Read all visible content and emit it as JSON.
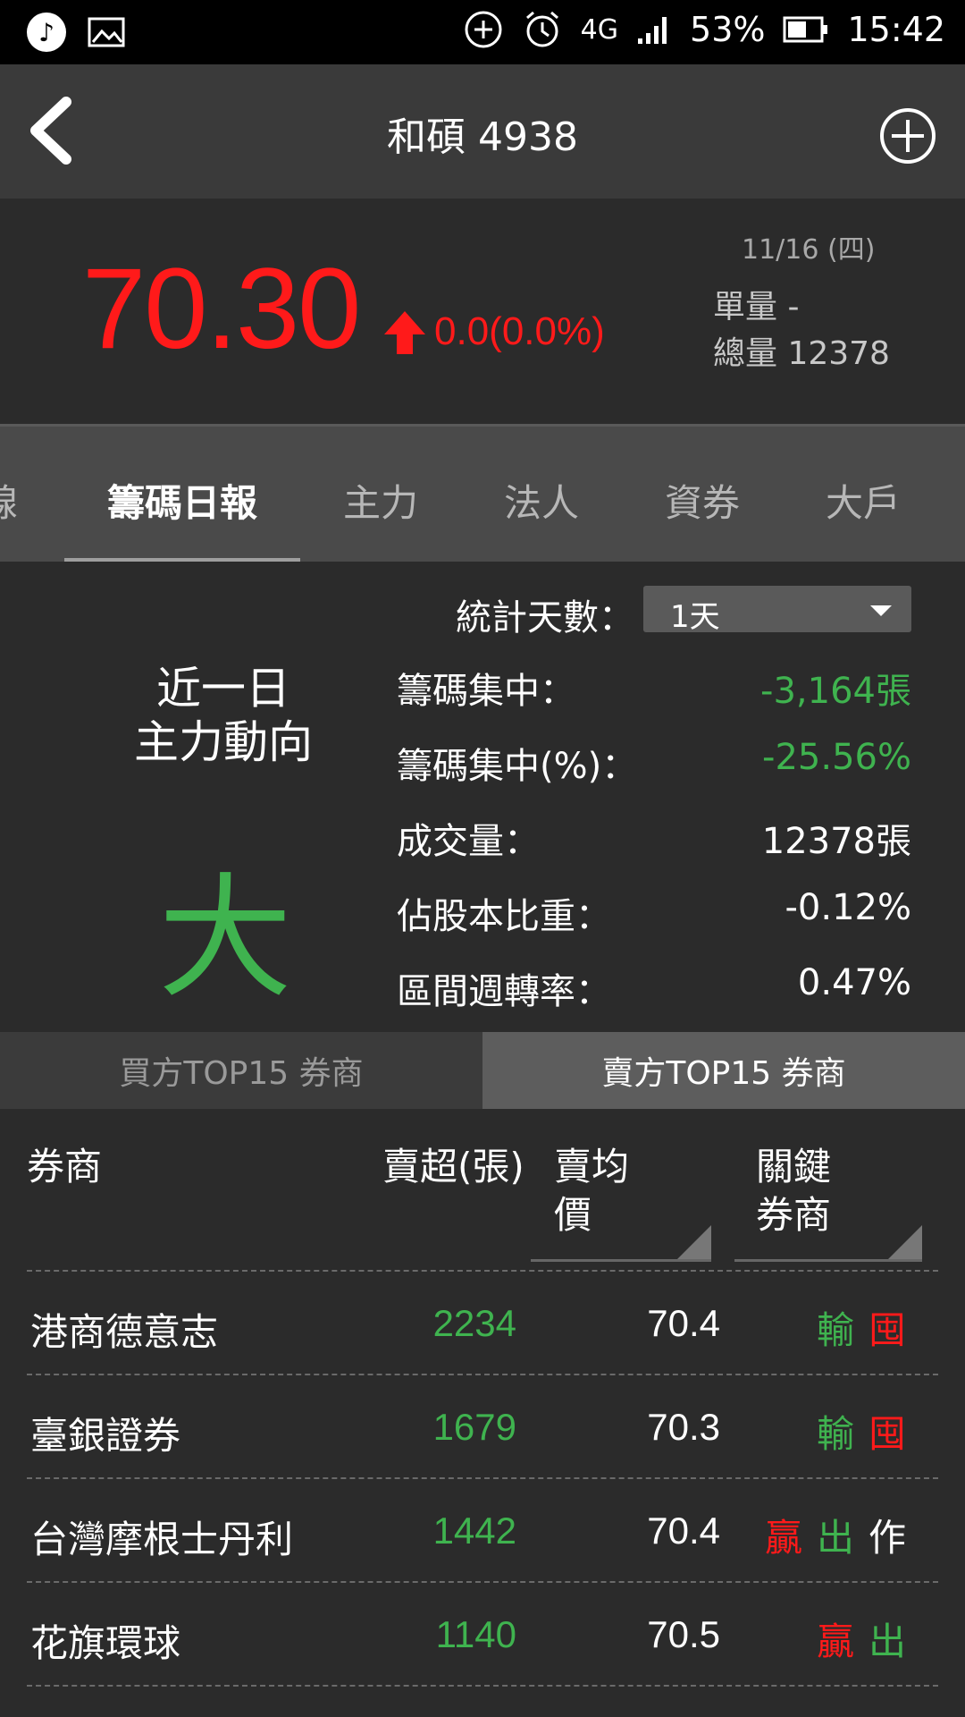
{
  "status_bar": {
    "battery": "53%",
    "time": "15:42",
    "network": "4G",
    "icons": [
      "music-note-icon",
      "gallery-icon",
      "data-saver-icon",
      "alarm-icon",
      "signal-icon",
      "battery-icon"
    ]
  },
  "app_bar": {
    "title": "和碩 4938",
    "back_icon": "chevron-left-icon",
    "add_icon": "plus-circle-icon"
  },
  "quote": {
    "price": "70.30",
    "change": "0.0(0.0%)",
    "date": "11/16 (四)",
    "single_volume": "單量 -",
    "total_volume": "總量 12378",
    "price_color": "#ff1a1a"
  },
  "tabs": [
    {
      "label": "線",
      "active": false
    },
    {
      "label": "籌碼日報",
      "active": true
    },
    {
      "label": "主力",
      "active": false
    },
    {
      "label": "法人",
      "active": false
    },
    {
      "label": "資券",
      "active": false
    },
    {
      "label": "大戶",
      "active": false
    }
  ],
  "stats": {
    "days_label": "統計天數：",
    "days_value": "1天",
    "recent_title_line1": "近一日",
    "recent_title_line2": "主力動向",
    "verdict": "大賣",
    "rows": [
      {
        "label": "籌碼集中：",
        "value": "-3,164張",
        "color": "green"
      },
      {
        "label": "籌碼集中(%)：",
        "value": "-25.56%",
        "color": "green"
      },
      {
        "label": "成交量：",
        "value": "12378張",
        "color": "white"
      },
      {
        "label": "佔股本比重：",
        "value": "-0.12%",
        "color": "white"
      },
      {
        "label": "區間週轉率：",
        "value": "0.47%",
        "color": "white"
      }
    ]
  },
  "side_tabs": {
    "buy": "買方TOP15 券商",
    "sell": "賣方TOP15 券商",
    "active": "sell"
  },
  "table": {
    "headers": {
      "broker": "券商",
      "net_sell": "賣超(張)",
      "avg_price_line1": "賣均",
      "avg_price_line2": "價",
      "key_line1": "關鍵",
      "key_line2": "券商"
    },
    "rows": [
      {
        "broker": "港商德意志",
        "qty": "2234",
        "avg": "70.4",
        "tags": [
          {
            "text": "輸",
            "color": "green"
          },
          {
            "text": "囤",
            "color": "red"
          }
        ]
      },
      {
        "broker": "臺銀證券",
        "qty": "1679",
        "avg": "70.3",
        "tags": [
          {
            "text": "輸",
            "color": "green"
          },
          {
            "text": "囤",
            "color": "red"
          }
        ]
      },
      {
        "broker": "台灣摩根士丹利",
        "qty": "1442",
        "avg": "70.4",
        "tags": [
          {
            "text": "贏",
            "color": "red"
          },
          {
            "text": "出",
            "color": "green"
          },
          {
            "text": "作",
            "color": "white"
          }
        ]
      },
      {
        "broker": "花旗環球",
        "qty": "1140",
        "avg": "70.5",
        "tags": [
          {
            "text": "贏",
            "color": "red"
          },
          {
            "text": "出",
            "color": "green"
          }
        ]
      }
    ]
  }
}
